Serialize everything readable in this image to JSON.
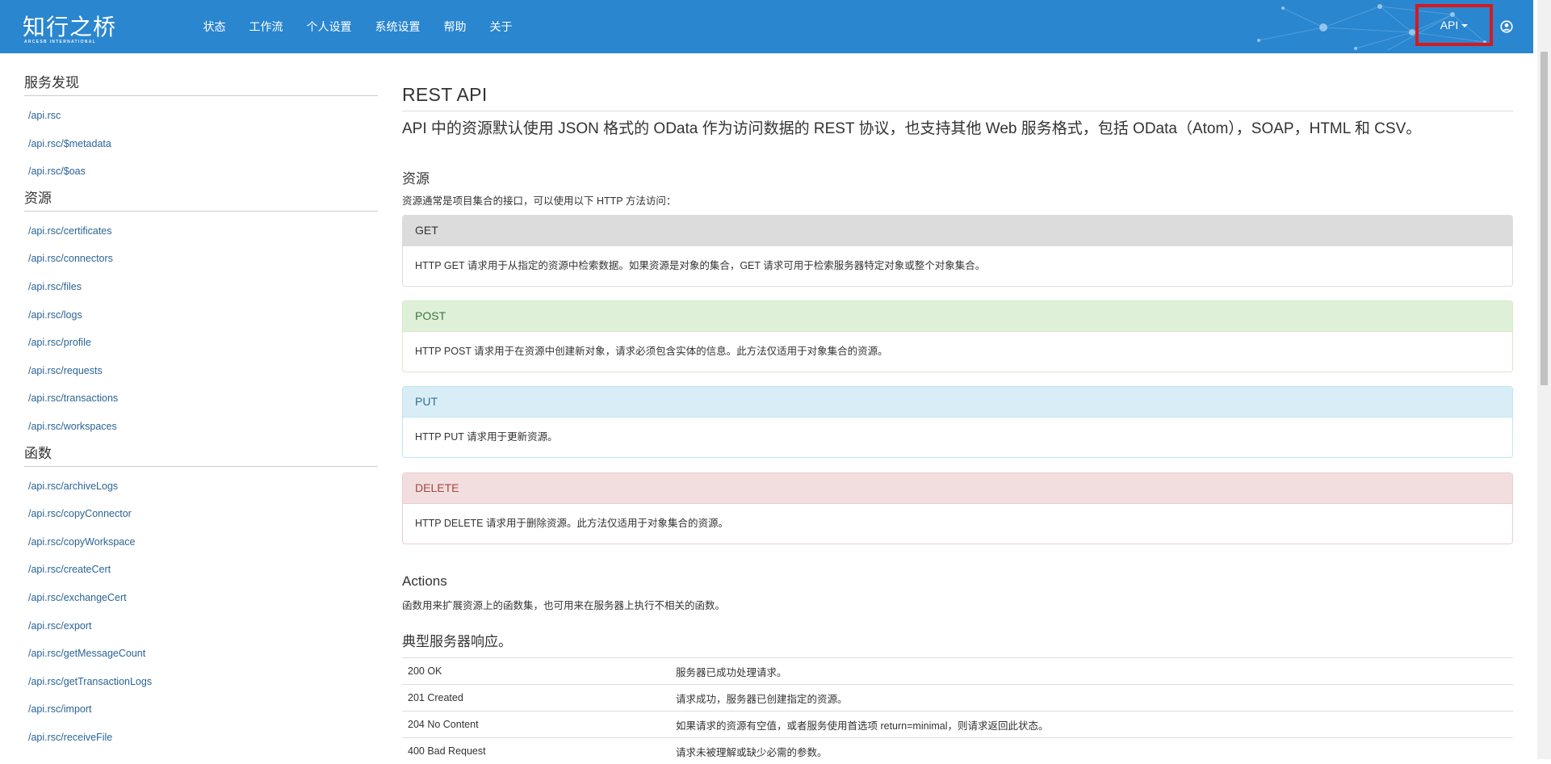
{
  "brand": {
    "name": "知行之桥",
    "tagline": "ARCESB INTERNATIONAL"
  },
  "nav": {
    "items": [
      {
        "label": "状态"
      },
      {
        "label": "工作流"
      },
      {
        "label": "个人设置"
      },
      {
        "label": "系统设置"
      },
      {
        "label": "帮助"
      },
      {
        "label": "关于"
      }
    ],
    "api_label": "API",
    "user_icon": "user-circle-icon",
    "highlight_color": "#d71920",
    "bar_color": "#2a86cf"
  },
  "sidebar": {
    "sections": [
      {
        "heading": "服务发现",
        "links": [
          "/api.rsc",
          "/api.rsc/$metadata",
          "/api.rsc/$oas"
        ]
      },
      {
        "heading": "资源",
        "links": [
          "/api.rsc/certificates",
          "/api.rsc/connectors",
          "/api.rsc/files",
          "/api.rsc/logs",
          "/api.rsc/profile",
          "/api.rsc/requests",
          "/api.rsc/transactions",
          "/api.rsc/workspaces"
        ]
      },
      {
        "heading": "函数",
        "links": [
          "/api.rsc/archiveLogs",
          "/api.rsc/copyConnector",
          "/api.rsc/copyWorkspace",
          "/api.rsc/createCert",
          "/api.rsc/exchangeCert",
          "/api.rsc/export",
          "/api.rsc/getMessageCount",
          "/api.rsc/getTransactionLogs",
          "/api.rsc/import",
          "/api.rsc/receiveFile"
        ]
      }
    ]
  },
  "main": {
    "title": "REST API",
    "lead": "API 中的资源默认使用 JSON 格式的 OData 作为访问数据的 REST 协议，也支持其他 Web 服务格式，包括 OData（Atom），SOAP，HTML 和 CSV。",
    "resources": {
      "title": "资源",
      "desc": "资源通常是项目集合的接口，可以使用以下 HTTP 方法访问："
    },
    "methods": [
      {
        "name": "GET",
        "desc": "HTTP GET 请求用于从指定的资源中检索数据。如果资源是对象的集合，GET 请求可用于检索服务器特定对象或整个对象集合。"
      },
      {
        "name": "POST",
        "desc": "HTTP POST 请求用于在资源中创建新对象，请求必须包含实体的信息。此方法仅适用于对象集合的资源。"
      },
      {
        "name": "PUT",
        "desc": "HTTP PUT 请求用于更新资源。"
      },
      {
        "name": "DELETE",
        "desc": "HTTP DELETE 请求用于删除资源。此方法仅适用于对象集合的资源。"
      }
    ],
    "actions": {
      "title": "Actions",
      "desc": "函数用来扩展资源上的函数集，也可用来在服务器上执行不相关的函数。"
    },
    "responses": {
      "title": "典型服务器响应。",
      "rows": [
        {
          "code": "200 OK",
          "desc": "服务器已成功处理请求。"
        },
        {
          "code": "201 Created",
          "desc": "请求成功，服务器已创建指定的资源。"
        },
        {
          "code": "204 No Content",
          "desc": "如果请求的资源有空值，或者服务使用首选项 return=minimal，则请求返回此状态。"
        },
        {
          "code": "400 Bad Request",
          "desc": "请求未被理解或缺少必需的参数。"
        }
      ]
    }
  }
}
